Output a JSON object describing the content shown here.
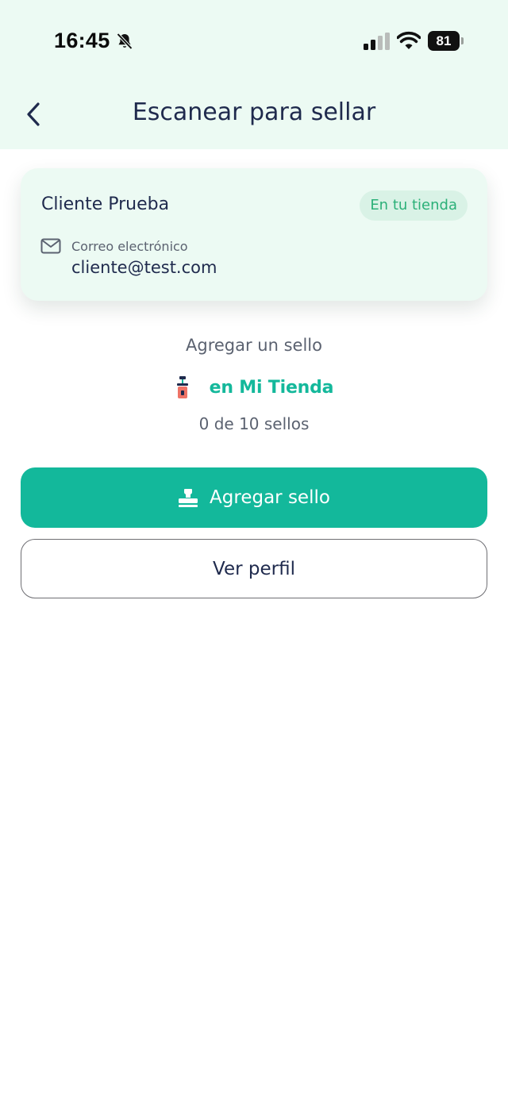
{
  "status_bar": {
    "time": "16:45",
    "battery": "81"
  },
  "header": {
    "title": "Escanear para sellar"
  },
  "customer": {
    "name": "Cliente Prueba",
    "badge": "En tu tienda",
    "email_label": "Correo electrónico",
    "email": "cliente@test.com"
  },
  "stamp_info": {
    "prompt": "Agregar un sello",
    "store_name": "en Mi Tienda",
    "count_text": "0 de 10 sellos"
  },
  "actions": {
    "add_stamp_label": "Agregar sello",
    "view_profile_label": "Ver perfil"
  },
  "colors": {
    "header_bg": "#ecfaf3",
    "accent": "#13b89b",
    "badge_text": "#2bb078",
    "text_primary": "#1f2a4d"
  },
  "icons": {
    "status": [
      "bell-slash-icon",
      "signal-icon",
      "wifi-icon",
      "battery-icon"
    ],
    "nav": "chevron-left-icon",
    "email": "mail-icon",
    "store": "store-logo-icon",
    "add_stamp": "stamp-icon"
  }
}
